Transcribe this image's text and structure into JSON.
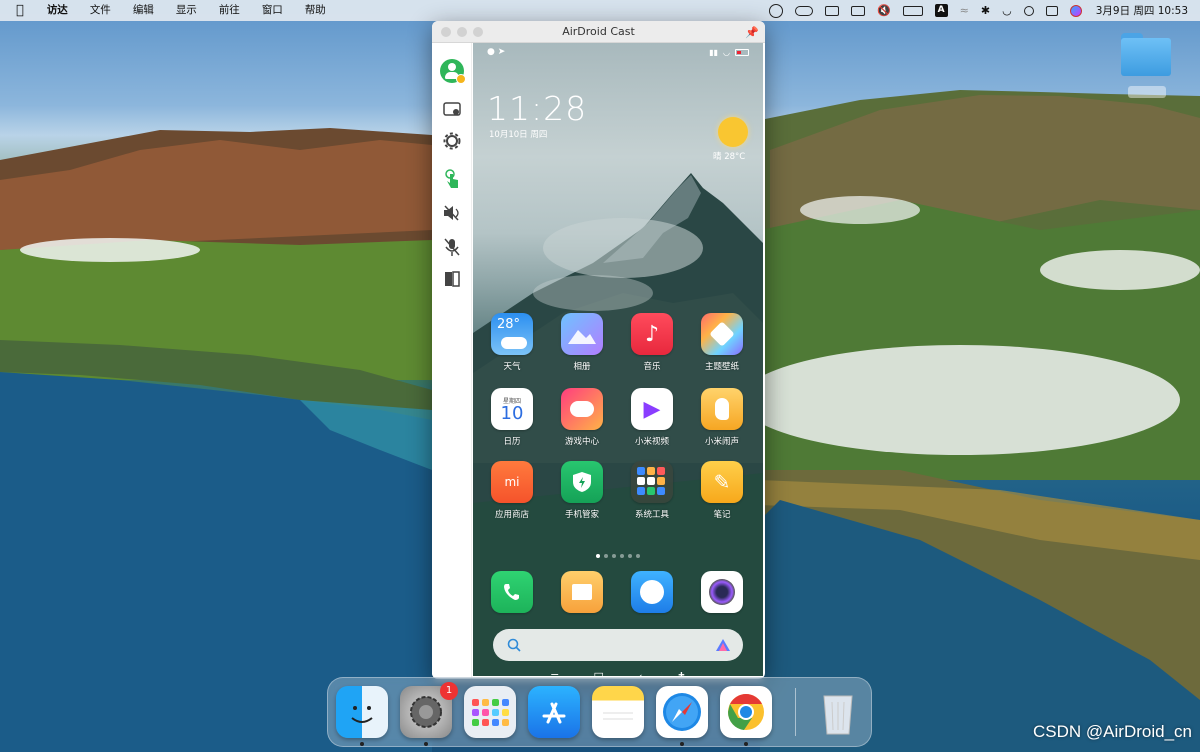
{
  "menubar": {
    "apple_icon": "apple-icon",
    "items": [
      "访达",
      "文件",
      "编辑",
      "显示",
      "前往",
      "窗口",
      "帮助"
    ],
    "clock": "3月9日 周四 10:53"
  },
  "desktop": {
    "folder_icon": "folder-icon"
  },
  "window": {
    "title": "AirDroid Cast",
    "sidebar_icons": [
      "avatar-icon",
      "screen-icon",
      "gear-icon",
      "touch-icon",
      "speaker-mute-icon",
      "mic-mute-icon",
      "book-icon"
    ]
  },
  "phone": {
    "time": "11:28",
    "date": "10月10日 周四",
    "weather": "晴  28°C",
    "apps": [
      {
        "label": "天气",
        "glyph": "28°"
      },
      {
        "label": "相册",
        "glyph": ""
      },
      {
        "label": "音乐",
        "glyph": "♪"
      },
      {
        "label": "主题壁纸",
        "glyph": ""
      },
      {
        "label": "日历",
        "glyph": "10",
        "sub": "星期四"
      },
      {
        "label": "游戏中心",
        "glyph": ""
      },
      {
        "label": "小米视频",
        "glyph": "▶"
      },
      {
        "label": "小米闹声",
        "glyph": ""
      },
      {
        "label": "应用商店",
        "glyph": "mi"
      },
      {
        "label": "手机管家",
        "glyph": ""
      },
      {
        "label": "系统工具",
        "glyph": ""
      },
      {
        "label": "笔记",
        "glyph": "✎"
      }
    ]
  },
  "dock": {
    "apps": [
      "finder",
      "system-preferences",
      "launchpad",
      "app-store",
      "notes",
      "safari",
      "chrome",
      "trash"
    ],
    "badge": "1"
  },
  "watermark": "CSDN @AirDroid_cn"
}
